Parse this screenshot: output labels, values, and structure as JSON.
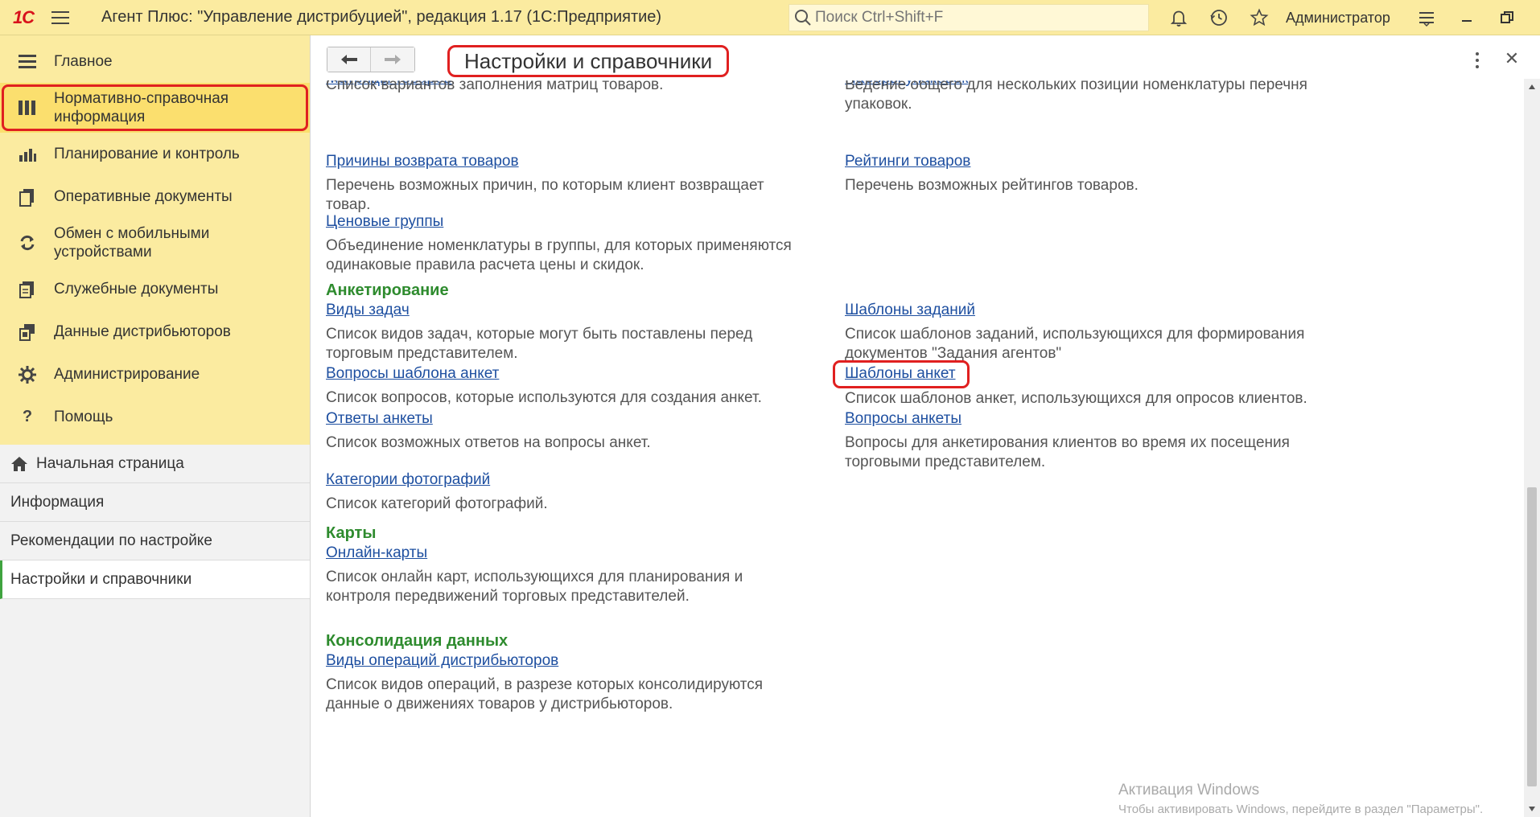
{
  "app": {
    "logo_text": "1С",
    "title": "Агент Плюс: \"Управление дистрибуцией\", редакция 1.17  (1С:Предприятие)",
    "search_placeholder": "Поиск Ctrl+Shift+F",
    "user": "Администратор"
  },
  "sidebar": {
    "sections": [
      {
        "label": "Главное",
        "icon": "menu-lines-icon"
      },
      {
        "label": "Нормативно-справочная информация",
        "icon": "book-columns-icon",
        "active": true
      },
      {
        "label": "Планирование и контроль",
        "icon": "bar-chart-icon"
      },
      {
        "label": "Оперативные документы",
        "icon": "documents-icon"
      },
      {
        "label": "Обмен с мобильными устройствами",
        "icon": "sync-icon"
      },
      {
        "label": "Служебные документы",
        "icon": "service-docs-icon"
      },
      {
        "label": "Данные дистрибьюторов",
        "icon": "distributor-data-icon"
      },
      {
        "label": "Администрирование",
        "icon": "gear-icon"
      },
      {
        "label": "Помощь",
        "icon": "question-icon"
      }
    ],
    "open_windows": [
      {
        "label": "Начальная страница",
        "icon": "home-icon"
      },
      {
        "label": "Информация"
      },
      {
        "label": "Рекомендации по настройке"
      },
      {
        "label": "Настройки и справочники",
        "current": true
      }
    ]
  },
  "page": {
    "title": "Настройки и справочники"
  },
  "content": {
    "top_cut": {
      "left_link": "Матрицы товаров",
      "left_desc": "Список вариантов заполнения матриц товаров.",
      "right_link": "Наборы упаковок",
      "right_desc": "Ведение общего для нескольких позиций номенклатуры перечня упаковок."
    },
    "returns": {
      "link": "Причины возврата товаров",
      "desc": "Перечень возможных причин, по которым клиент возвращает товар."
    },
    "ratings": {
      "link": "Рейтинги товаров",
      "desc": "Перечень возможных рейтингов товаров."
    },
    "price_groups": {
      "link": "Ценовые группы",
      "desc": "Объединение номенклатуры в группы, для которых применяются одинаковые правила расчета цены и скидок."
    },
    "survey": {
      "title": "Анкетирование",
      "task_types": {
        "link": "Виды задач",
        "desc": "Список видов задач, которые могут быть поставлены перед торговым представителем."
      },
      "task_templates": {
        "link": "Шаблоны заданий",
        "desc": "Список шаблонов заданий, использующихся для формирования документов \"Задания агентов\""
      },
      "template_questions": {
        "link": "Вопросы шаблона анкет",
        "desc": "Список вопросов, которые используются для создания анкет."
      },
      "survey_templates": {
        "link": "Шаблоны анкет",
        "desc": "Список шаблонов анкет, использующихся для опросов клиентов."
      },
      "answers": {
        "link": "Ответы анкеты",
        "desc": "Список возможных ответов на вопросы анкет."
      },
      "questions": {
        "link": "Вопросы анкеты",
        "desc": "Вопросы для анкетирования клиентов во время их посещения торговыми представителем."
      },
      "photo_categories": {
        "link": "Категории фотографий",
        "desc": "Список категорий фотографий."
      }
    },
    "maps": {
      "title": "Карты",
      "online": {
        "link": "Онлайн-карты",
        "desc": "Список онлайн карт, использующихся для планирования и контроля передвижений торговых представителей."
      }
    },
    "consolidation": {
      "title": "Консолидация данных",
      "ops": {
        "link": "Виды операций дистрибьюторов",
        "desc": "Список видов операций, в разрезе которых консолидируются данные о движениях товаров у дистрибьюторов."
      }
    }
  },
  "watermark": {
    "line1": "Активация Windows",
    "line2": "Чтобы активировать Windows, перейдите в раздел \"Параметры\"."
  },
  "colors": {
    "topbar": "#fbeba0",
    "link": "#1e4fa0",
    "group_title": "#2e8b2e",
    "highlight": "#e02020"
  }
}
